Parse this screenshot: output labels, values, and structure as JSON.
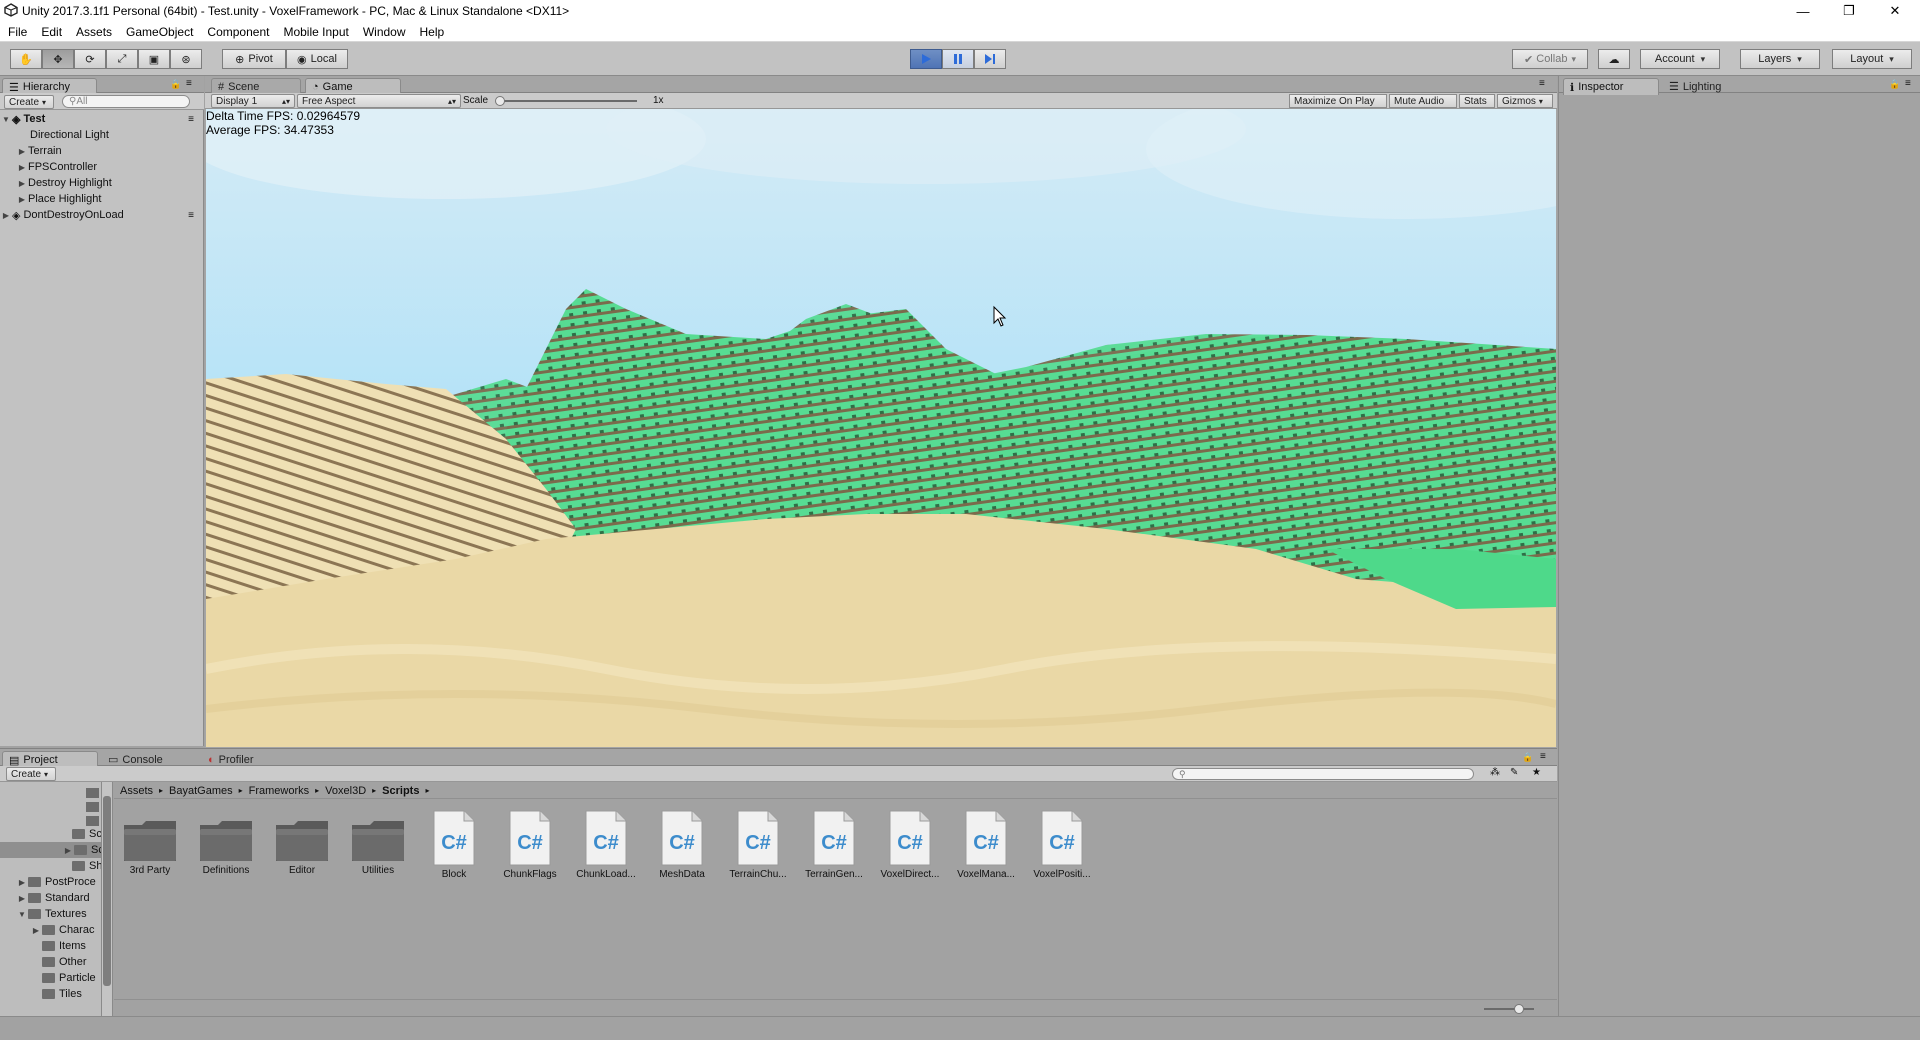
{
  "window": {
    "title": "Unity 2017.3.1f1 Personal (64bit) - Test.unity - VoxelFramework - PC, Mac & Linux Standalone <DX11>",
    "controls": [
      "—",
      "❐",
      "✕"
    ]
  },
  "menu": [
    "File",
    "Edit",
    "Assets",
    "GameObject",
    "Component",
    "Mobile Input",
    "Window",
    "Help"
  ],
  "toolbar": {
    "pivot": "Pivot",
    "local": "Local",
    "collab": "Collab",
    "account": "Account",
    "layers": "Layers",
    "layout": "Layout"
  },
  "hierarchy": {
    "tab": "Hierarchy",
    "create": "Create",
    "search_placeholder": "All",
    "items": [
      {
        "label": "Test",
        "kind": "scene",
        "expanded": true
      },
      {
        "label": "Directional Light",
        "kind": "child"
      },
      {
        "label": "Terrain",
        "kind": "child-collapsed"
      },
      {
        "label": "FPSController",
        "kind": "child-collapsed"
      },
      {
        "label": "Destroy Highlight",
        "kind": "child-collapsed"
      },
      {
        "label": "Place Highlight",
        "kind": "child-collapsed"
      },
      {
        "label": "DontDestroyOnLoad",
        "kind": "scene",
        "expanded": false
      }
    ]
  },
  "views": {
    "scene_tab": "Scene",
    "game_tab": "Game",
    "display": "Display 1",
    "aspect": "Free Aspect",
    "scale_label": "Scale",
    "scale_value": "1x",
    "maximize": "Maximize On Play",
    "mute": "Mute Audio",
    "stats": "Stats",
    "gizmos": "Gizmos",
    "delta_fps": "Delta Time FPS: 0.02964579",
    "avg_fps": "Average FPS: 34.47353"
  },
  "inspector": {
    "tab": "Inspector",
    "lighting_tab": "Lighting"
  },
  "project": {
    "tab": "Project",
    "console_tab": "Console",
    "profiler_tab": "Profiler",
    "create": "Create",
    "breadcrumb": [
      "Assets",
      "BayatGames",
      "Frameworks",
      "Voxel3D",
      "Scripts"
    ],
    "tree": [
      {
        "label": "Sc",
        "indent": 2
      },
      {
        "label": "Sc",
        "indent": 2,
        "selected": true
      },
      {
        "label": "Sh",
        "indent": 2
      },
      {
        "label": "PostProce",
        "indent": 1
      },
      {
        "label": "Standard",
        "indent": 1
      },
      {
        "label": "Textures",
        "indent": 1
      },
      {
        "label": "Charac",
        "indent": 2
      },
      {
        "label": "Items",
        "indent": 2
      },
      {
        "label": "Other",
        "indent": 2
      },
      {
        "label": "Particle",
        "indent": 2
      },
      {
        "label": "Tiles",
        "indent": 2
      }
    ],
    "assets": [
      {
        "label": "3rd Party",
        "type": "folder"
      },
      {
        "label": "Definitions",
        "type": "folder"
      },
      {
        "label": "Editor",
        "type": "folder"
      },
      {
        "label": "Utilities",
        "type": "folder"
      },
      {
        "label": "Block",
        "type": "cs"
      },
      {
        "label": "ChunkFlags",
        "type": "cs"
      },
      {
        "label": "ChunkLoad...",
        "type": "cs"
      },
      {
        "label": "MeshData",
        "type": "cs"
      },
      {
        "label": "TerrainChu...",
        "type": "cs"
      },
      {
        "label": "TerrainGen...",
        "type": "cs"
      },
      {
        "label": "VoxelDirect...",
        "type": "cs"
      },
      {
        "label": "VoxelMana...",
        "type": "cs"
      },
      {
        "label": "VoxelPositi...",
        "type": "cs"
      }
    ]
  },
  "colors": {
    "sky_top": "#cfe6f3",
    "sky_bottom": "#a9ddf3",
    "grass": "#52d98e",
    "sand": "#e8d8a8",
    "play_accent": "#4f74b5"
  }
}
